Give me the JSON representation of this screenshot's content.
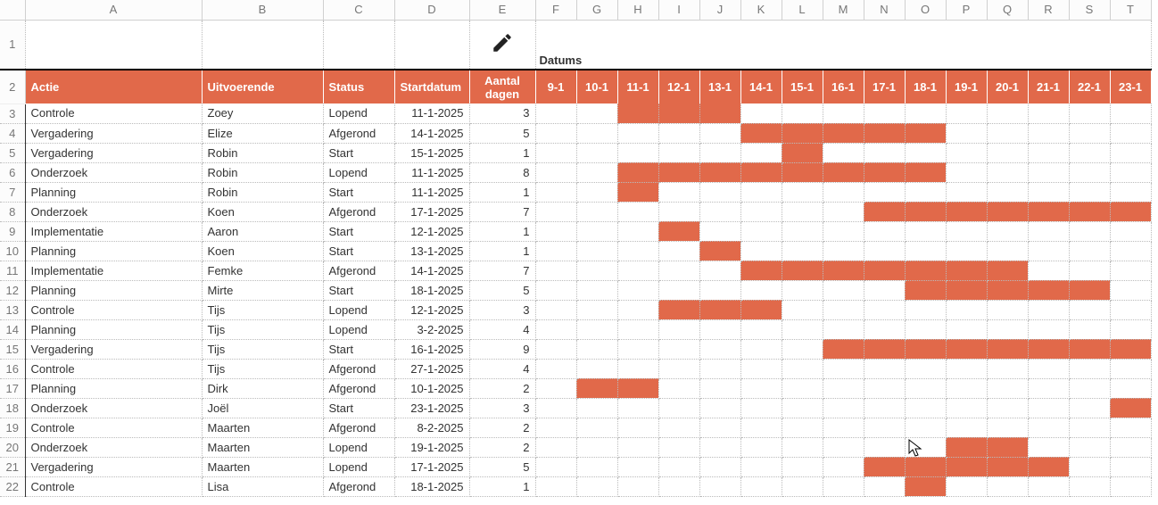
{
  "labels": {
    "datums": "Datums",
    "headers": [
      "Actie",
      "Uitvoerende",
      "Status",
      "Startdatum",
      "Aantal dagen"
    ]
  },
  "columns": [
    "A",
    "B",
    "C",
    "D",
    "E",
    "F",
    "G",
    "H",
    "I",
    "J",
    "K",
    "L",
    "M",
    "N",
    "O",
    "P",
    "Q",
    "R",
    "S",
    "T"
  ],
  "dates": [
    "9-1",
    "10-1",
    "11-1",
    "12-1",
    "13-1",
    "14-1",
    "15-1",
    "16-1",
    "17-1",
    "18-1",
    "19-1",
    "20-1",
    "21-1",
    "22-1",
    "23-1"
  ],
  "firstDateDay": 9,
  "rows": [
    {
      "n": 3,
      "actie": "Controle",
      "uitv": "Zoey",
      "status": "Lopend",
      "start": "11-1-2025",
      "dagen": "3",
      "startDay": 11,
      "len": 3
    },
    {
      "n": 4,
      "actie": "Vergadering",
      "uitv": "Elize",
      "status": "Afgerond",
      "start": "14-1-2025",
      "dagen": "5",
      "startDay": 14,
      "len": 5
    },
    {
      "n": 5,
      "actie": "Vergadering",
      "uitv": "Robin",
      "status": "Start",
      "start": "15-1-2025",
      "dagen": "1",
      "startDay": 15,
      "len": 1
    },
    {
      "n": 6,
      "actie": "Onderzoek",
      "uitv": "Robin",
      "status": "Lopend",
      "start": "11-1-2025",
      "dagen": "8",
      "startDay": 11,
      "len": 8
    },
    {
      "n": 7,
      "actie": "Planning",
      "uitv": "Robin",
      "status": "Start",
      "start": "11-1-2025",
      "dagen": "1",
      "startDay": 11,
      "len": 1
    },
    {
      "n": 8,
      "actie": "Onderzoek",
      "uitv": "Koen",
      "status": "Afgerond",
      "start": "17-1-2025",
      "dagen": "7",
      "startDay": 17,
      "len": 7
    },
    {
      "n": 9,
      "actie": "Implementatie",
      "uitv": "Aaron",
      "status": "Start",
      "start": "12-1-2025",
      "dagen": "1",
      "startDay": 12,
      "len": 1
    },
    {
      "n": 10,
      "actie": "Planning",
      "uitv": "Koen",
      "status": "Start",
      "start": "13-1-2025",
      "dagen": "1",
      "startDay": 13,
      "len": 1
    },
    {
      "n": 11,
      "actie": "Implementatie",
      "uitv": "Femke",
      "status": "Afgerond",
      "start": "14-1-2025",
      "dagen": "7",
      "startDay": 14,
      "len": 7
    },
    {
      "n": 12,
      "actie": "Planning",
      "uitv": "Mirte",
      "status": "Start",
      "start": "18-1-2025",
      "dagen": "5",
      "startDay": 18,
      "len": 5
    },
    {
      "n": 13,
      "actie": "Controle",
      "uitv": "Tijs",
      "status": "Lopend",
      "start": "12-1-2025",
      "dagen": "3",
      "startDay": 12,
      "len": 3
    },
    {
      "n": 14,
      "actie": "Planning",
      "uitv": "Tijs",
      "status": "Lopend",
      "start": "3-2-2025",
      "dagen": "4",
      "startDay": 34,
      "len": 4
    },
    {
      "n": 15,
      "actie": "Vergadering",
      "uitv": "Tijs",
      "status": "Start",
      "start": "16-1-2025",
      "dagen": "9",
      "startDay": 16,
      "len": 9
    },
    {
      "n": 16,
      "actie": "Controle",
      "uitv": "Tijs",
      "status": "Afgerond",
      "start": "27-1-2025",
      "dagen": "4",
      "startDay": 27,
      "len": 4
    },
    {
      "n": 17,
      "actie": "Planning",
      "uitv": "Dirk",
      "status": "Afgerond",
      "start": "10-1-2025",
      "dagen": "2",
      "startDay": 10,
      "len": 2
    },
    {
      "n": 18,
      "actie": "Onderzoek",
      "uitv": "Joël",
      "status": "Start",
      "start": "23-1-2025",
      "dagen": "3",
      "startDay": 23,
      "len": 3
    },
    {
      "n": 19,
      "actie": "Controle",
      "uitv": "Maarten",
      "status": "Afgerond",
      "start": "8-2-2025",
      "dagen": "2",
      "startDay": 39,
      "len": 2
    },
    {
      "n": 20,
      "actie": "Onderzoek",
      "uitv": "Maarten",
      "status": "Lopend",
      "start": "19-1-2025",
      "dagen": "2",
      "startDay": 19,
      "len": 2
    },
    {
      "n": 21,
      "actie": "Vergadering",
      "uitv": "Maarten",
      "status": "Lopend",
      "start": "17-1-2025",
      "dagen": "5",
      "startDay": 17,
      "len": 5
    },
    {
      "n": 22,
      "actie": "Controle",
      "uitv": "Lisa",
      "status": "Afgerond",
      "start": "18-1-2025",
      "dagen": "1",
      "startDay": 18,
      "len": 1
    }
  ],
  "colWidths": {
    "rownum": 28,
    "A": 198,
    "B": 136,
    "C": 80,
    "D": 84,
    "E": 74,
    "date": 46
  },
  "chart_data": {
    "type": "bar",
    "title": "Datums",
    "xlabel": "",
    "ylabel": "",
    "x_tick_labels": [
      "9-1",
      "10-1",
      "11-1",
      "12-1",
      "13-1",
      "14-1",
      "15-1",
      "16-1",
      "17-1",
      "18-1",
      "19-1",
      "20-1",
      "21-1",
      "22-1",
      "23-1"
    ],
    "series": [
      {
        "name": "Controle – Zoey",
        "start": "11-1",
        "length": 3
      },
      {
        "name": "Vergadering – Elize",
        "start": "14-1",
        "length": 5
      },
      {
        "name": "Vergadering – Robin",
        "start": "15-1",
        "length": 1
      },
      {
        "name": "Onderzoek – Robin",
        "start": "11-1",
        "length": 8
      },
      {
        "name": "Planning – Robin",
        "start": "11-1",
        "length": 1
      },
      {
        "name": "Onderzoek – Koen",
        "start": "17-1",
        "length": 7
      },
      {
        "name": "Implementatie – Aaron",
        "start": "12-1",
        "length": 1
      },
      {
        "name": "Planning – Koen",
        "start": "13-1",
        "length": 1
      },
      {
        "name": "Implementatie – Femke",
        "start": "14-1",
        "length": 7
      },
      {
        "name": "Planning – Mirte",
        "start": "18-1",
        "length": 5
      },
      {
        "name": "Controle – Tijs",
        "start": "12-1",
        "length": 3
      },
      {
        "name": "Planning – Tijs",
        "start": "3-2",
        "length": 4
      },
      {
        "name": "Vergadering – Tijs",
        "start": "16-1",
        "length": 9
      },
      {
        "name": "Controle – Tijs",
        "start": "27-1",
        "length": 4
      },
      {
        "name": "Planning – Dirk",
        "start": "10-1",
        "length": 2
      },
      {
        "name": "Onderzoek – Joël",
        "start": "23-1",
        "length": 3
      },
      {
        "name": "Controle – Maarten",
        "start": "8-2",
        "length": 2
      },
      {
        "name": "Onderzoek – Maarten",
        "start": "19-1",
        "length": 2
      },
      {
        "name": "Vergadering – Maarten",
        "start": "17-1",
        "length": 5
      },
      {
        "name": "Controle – Lisa",
        "start": "18-1",
        "length": 1
      }
    ]
  }
}
